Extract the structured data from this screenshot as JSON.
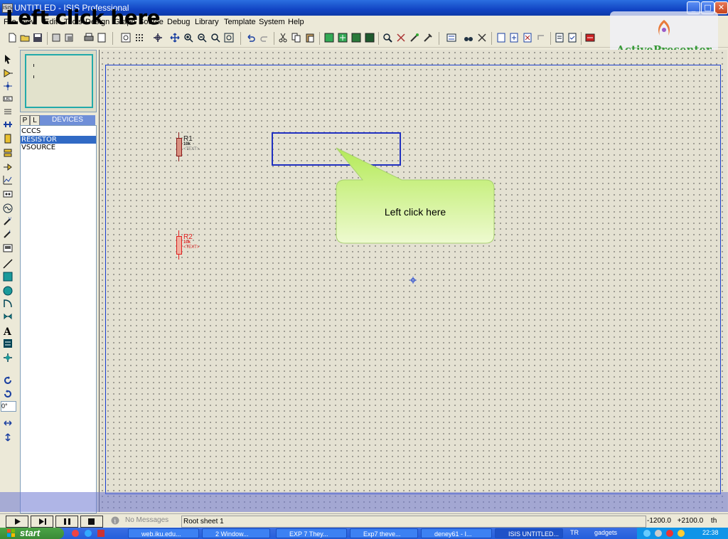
{
  "window": {
    "title": "UNTITLED - ISIS Professional",
    "app_icon": "ISIS",
    "minimize": "_",
    "maximize": "□",
    "close": "✕"
  },
  "overlay_caption": "Left click here",
  "menu": [
    "File",
    "View",
    "Edit",
    "Tools",
    "Design",
    "Graph",
    "Source",
    "Debug",
    "Library",
    "Template",
    "System",
    "Help"
  ],
  "active_presenter": {
    "label": "ActivePresenter"
  },
  "device_panel": {
    "tab_p": "P",
    "tab_l": "L",
    "header": "DEVICES",
    "items": [
      "CCCS",
      "RESISTOR",
      "VSOURCE"
    ],
    "selected_index": 1
  },
  "components": [
    {
      "name": "R1",
      "value": "10k",
      "text": "<TEXT>",
      "color": "#8b1a1a"
    },
    {
      "name": "R2",
      "value": "10k",
      "text": "<TEXT>",
      "color": "#e02020"
    }
  ],
  "callout": {
    "text": "Left click here"
  },
  "left_rotation_field": "0°",
  "status": {
    "messages": "No Messages",
    "sheet": "Root sheet 1",
    "x": "-1200.0",
    "y": "+2100.0",
    "units": "th"
  },
  "taskbar": {
    "start": "start",
    "tasks": [
      "web.iku.edu...",
      "2 Window...",
      "EXP 7 They...",
      "Exp7 theve...",
      "deney61 - I...",
      "ISIS UNTITLED..."
    ],
    "tray_lang": "TR",
    "tray_toolbar": "gadgets",
    "clock": "22:38"
  },
  "colors": {
    "accent": "#316ac5",
    "sheet_border": "#1a3fd0",
    "callout_fill": "#c8f070"
  }
}
